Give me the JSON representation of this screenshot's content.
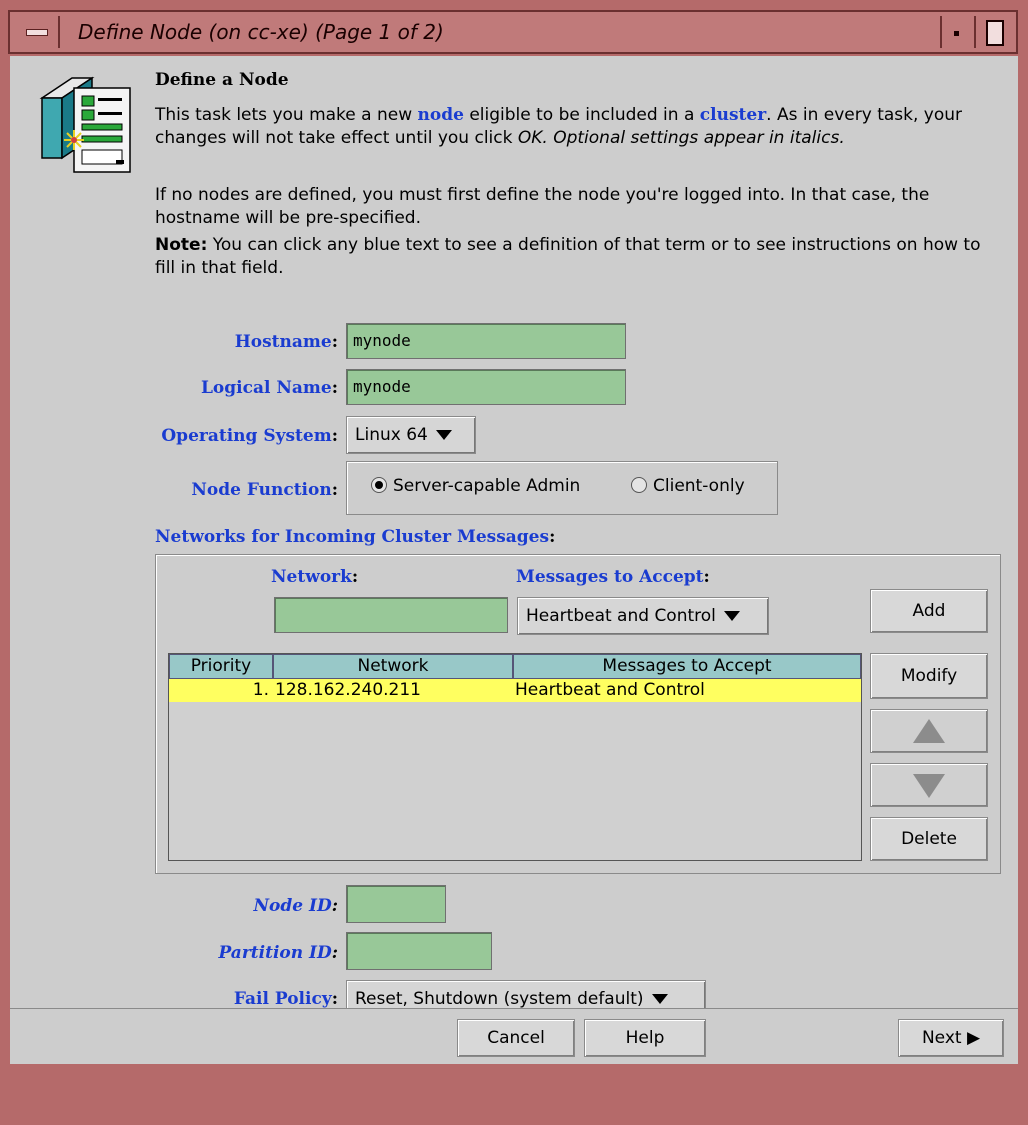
{
  "window": {
    "title": "Define Node (on cc-xe) (Page 1 of 2)"
  },
  "intro": {
    "heading": "Define a Node",
    "p1_a": "This task lets you make a new ",
    "p1_link1": "node",
    "p1_b": " eligible to be included in a ",
    "p1_link2": "cluster",
    "p1_c": ". As in every task, your changes will not take effect until you click ",
    "p1_ok": "OK.",
    "p1_optional": "  Optional settings appear in italics.",
    "p2": "If no nodes are defined, you must first define the node you're logged into.  In that case, the hostname will be pre-specified.",
    "p3_bold": "Note:",
    "p3_rest": " You can click any blue text to see a definition of that term or to see instructions on how to fill in that field."
  },
  "form": {
    "hostname_label": "Hostname",
    "hostname_value": "mynode",
    "logical_label": "Logical Name",
    "logical_value": "mynode",
    "os_label": "Operating System",
    "os_value": "Linux 64",
    "function_label": "Node Function",
    "function_options": [
      "Server-capable Admin",
      "Client-only"
    ],
    "networks_label": "Networks for Incoming Cluster Messages",
    "network_label": "Network",
    "network_value": "",
    "messages_label": "Messages to Accept",
    "messages_value": "Heartbeat and Control",
    "node_id_label": "Node ID",
    "node_id_value": "",
    "partition_id_label": "Partition ID",
    "partition_id_value": "",
    "fail_policy_label": "Fail Policy",
    "fail_policy_value": "Reset, Shutdown (system default)"
  },
  "table": {
    "headers": [
      "Priority",
      "Network",
      "Messages to Accept"
    ],
    "rows": [
      {
        "priority": "1.",
        "network": "128.162.240.211",
        "messages": "Heartbeat and Control"
      }
    ]
  },
  "buttons": {
    "add": "Add",
    "modify": "Modify",
    "delete": "Delete",
    "cancel": "Cancel",
    "help": "Help",
    "next": "Next"
  },
  "colors": {
    "title_bar": "#c07a7a",
    "field_bg": "#98c898",
    "link": "#1a3cd0",
    "table_header": "#98c8c8",
    "selected_row": "#ffff60"
  },
  "icons": [
    "window-menu-icon",
    "minimize-icon",
    "maximize-icon",
    "task-icon",
    "up-arrow-icon",
    "down-arrow-icon",
    "next-arrow-icon"
  ]
}
